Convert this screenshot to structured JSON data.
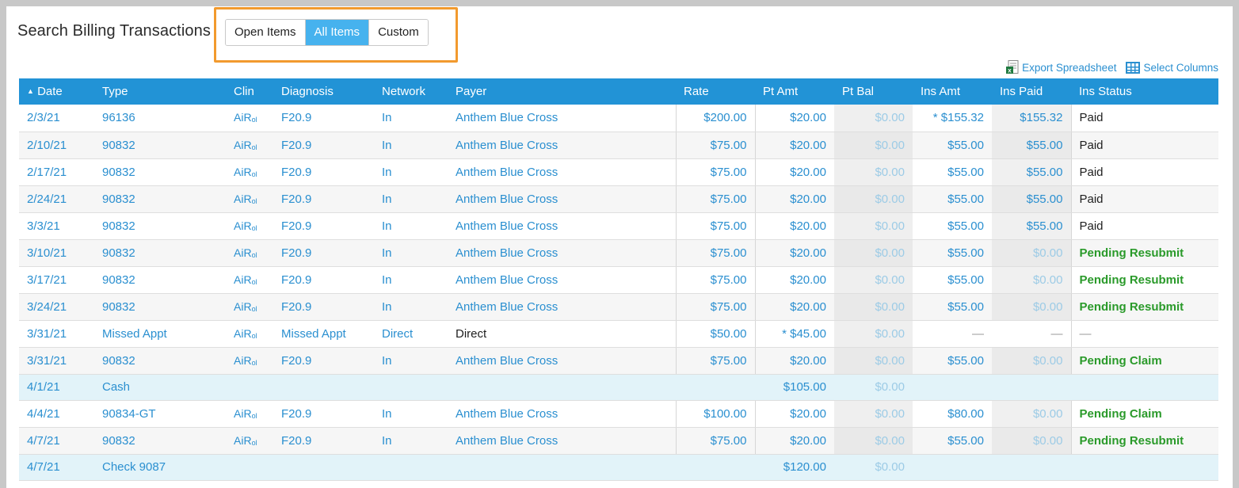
{
  "title": "Search Billing Transactions",
  "filter": {
    "options": [
      "Open Items",
      "All Items",
      "Custom"
    ],
    "selected": "All Items"
  },
  "tools": {
    "export_label": "Export Spreadsheet",
    "columns_label": "Select Columns"
  },
  "table": {
    "headers": {
      "date": "Date",
      "type": "Type",
      "clin": "Clin",
      "diagnosis": "Diagnosis",
      "network": "Network",
      "payer": "Payer",
      "rate": "Rate",
      "pt_amt": "Pt Amt",
      "pt_bal": "Pt Bal",
      "ins_amt": "Ins Amt",
      "ins_paid": "Ins Paid",
      "ins_status": "Ins Status"
    },
    "sort_indicator": "▲",
    "rows": [
      {
        "date": "2/3/21",
        "type": "96136",
        "clin": "AiR",
        "clin_sub": "ol",
        "diagnosis": "F20.9",
        "network": "In",
        "payer": "Anthem Blue Cross",
        "rate": "$200.00",
        "pt_amt": "$20.00",
        "pt_bal": "$0.00",
        "ins_amt": "* $155.32",
        "ins_paid": "$155.32",
        "ins_status": "Paid"
      },
      {
        "date": "2/10/21",
        "type": "90832",
        "clin": "AiR",
        "clin_sub": "ol",
        "diagnosis": "F20.9",
        "network": "In",
        "payer": "Anthem Blue Cross",
        "rate": "$75.00",
        "pt_amt": "$20.00",
        "pt_bal": "$0.00",
        "ins_amt": "$55.00",
        "ins_paid": "$55.00",
        "ins_status": "Paid"
      },
      {
        "date": "2/17/21",
        "type": "90832",
        "clin": "AiR",
        "clin_sub": "ol",
        "diagnosis": "F20.9",
        "network": "In",
        "payer": "Anthem Blue Cross",
        "rate": "$75.00",
        "pt_amt": "$20.00",
        "pt_bal": "$0.00",
        "ins_amt": "$55.00",
        "ins_paid": "$55.00",
        "ins_status": "Paid"
      },
      {
        "date": "2/24/21",
        "type": "90832",
        "clin": "AiR",
        "clin_sub": "ol",
        "diagnosis": "F20.9",
        "network": "In",
        "payer": "Anthem Blue Cross",
        "rate": "$75.00",
        "pt_amt": "$20.00",
        "pt_bal": "$0.00",
        "ins_amt": "$55.00",
        "ins_paid": "$55.00",
        "ins_status": "Paid"
      },
      {
        "date": "3/3/21",
        "type": "90832",
        "clin": "AiR",
        "clin_sub": "ol",
        "diagnosis": "F20.9",
        "network": "In",
        "payer": "Anthem Blue Cross",
        "rate": "$75.00",
        "pt_amt": "$20.00",
        "pt_bal": "$0.00",
        "ins_amt": "$55.00",
        "ins_paid": "$55.00",
        "ins_status": "Paid"
      },
      {
        "date": "3/10/21",
        "type": "90832",
        "clin": "AiR",
        "clin_sub": "ol",
        "diagnosis": "F20.9",
        "network": "In",
        "payer": "Anthem Blue Cross",
        "rate": "$75.00",
        "pt_amt": "$20.00",
        "pt_bal": "$0.00",
        "ins_amt": "$55.00",
        "ins_paid": "$0.00",
        "ins_status": "Pending Resubmit"
      },
      {
        "date": "3/17/21",
        "type": "90832",
        "clin": "AiR",
        "clin_sub": "ol",
        "diagnosis": "F20.9",
        "network": "In",
        "payer": "Anthem Blue Cross",
        "rate": "$75.00",
        "pt_amt": "$20.00",
        "pt_bal": "$0.00",
        "ins_amt": "$55.00",
        "ins_paid": "$0.00",
        "ins_status": "Pending Resubmit"
      },
      {
        "date": "3/24/21",
        "type": "90832",
        "clin": "AiR",
        "clin_sub": "ol",
        "diagnosis": "F20.9",
        "network": "In",
        "payer": "Anthem Blue Cross",
        "rate": "$75.00",
        "pt_amt": "$20.00",
        "pt_bal": "$0.00",
        "ins_amt": "$55.00",
        "ins_paid": "$0.00",
        "ins_status": "Pending Resubmit"
      },
      {
        "date": "3/31/21",
        "type": "Missed Appt",
        "clin": "AiR",
        "clin_sub": "ol",
        "diagnosis": "Missed Appt",
        "network": "Direct",
        "payer": "Direct",
        "rate": "$50.00",
        "pt_amt": "* $45.00",
        "pt_bal": "$0.00",
        "ins_amt": "—",
        "ins_paid": "—",
        "ins_status": "—"
      },
      {
        "date": "3/31/21",
        "type": "90832",
        "clin": "AiR",
        "clin_sub": "ol",
        "diagnosis": "F20.9",
        "network": "In",
        "payer": "Anthem Blue Cross",
        "rate": "$75.00",
        "pt_amt": "$20.00",
        "pt_bal": "$0.00",
        "ins_amt": "$55.00",
        "ins_paid": "$0.00",
        "ins_status": "Pending Claim"
      },
      {
        "date": "4/1/21",
        "type": "Cash",
        "payment": true,
        "pt_amt": "$105.00",
        "pt_bal": "$0.00"
      },
      {
        "date": "4/4/21",
        "type": "90834-GT",
        "clin": "AiR",
        "clin_sub": "ol",
        "diagnosis": "F20.9",
        "network": "In",
        "payer": "Anthem Blue Cross",
        "rate": "$100.00",
        "pt_amt": "$20.00",
        "pt_bal": "$0.00",
        "ins_amt": "$80.00",
        "ins_paid": "$0.00",
        "ins_status": "Pending Claim"
      },
      {
        "date": "4/7/21",
        "type": "90832",
        "clin": "AiR",
        "clin_sub": "ol",
        "diagnosis": "F20.9",
        "network": "In",
        "payer": "Anthem Blue Cross",
        "rate": "$75.00",
        "pt_amt": "$20.00",
        "pt_bal": "$0.00",
        "ins_amt": "$55.00",
        "ins_paid": "$0.00",
        "ins_status": "Pending Resubmit"
      },
      {
        "date": "4/7/21",
        "type": "Check 9087",
        "payment": true,
        "pt_amt": "$120.00",
        "pt_bal": "$0.00"
      }
    ]
  },
  "colors": {
    "header_bg": "#2293d6",
    "link": "#2a8fd0",
    "active_segment": "#46b2ee",
    "highlight_border": "#f29a2e",
    "pending_status": "#2a9a2a",
    "payment_row_bg": "#e2f3f9"
  },
  "icons": {
    "export": "spreadsheet-icon",
    "columns": "table-grid-icon"
  }
}
